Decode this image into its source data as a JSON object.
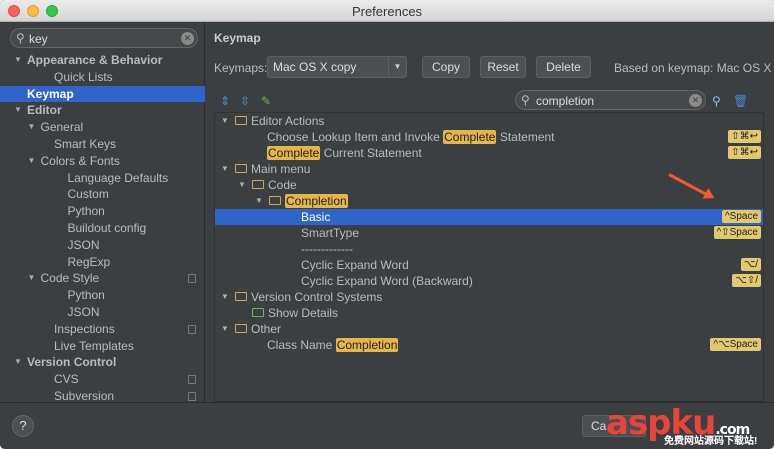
{
  "window": {
    "title": "Preferences"
  },
  "sidebar": {
    "search_value": "key",
    "items": [
      {
        "label": "Appearance & Behavior",
        "indent": 0,
        "arrow": true,
        "bold": true
      },
      {
        "label": "Quick Lists",
        "indent": 2
      },
      {
        "label": "Keymap",
        "indent": 1,
        "selected": true
      },
      {
        "label": "Editor",
        "indent": 0,
        "arrow": true,
        "bold": true
      },
      {
        "label": "General",
        "indent": 1,
        "arrow": true
      },
      {
        "label": "Smart Keys",
        "indent": 2
      },
      {
        "label": "Colors & Fonts",
        "indent": 1,
        "arrow": true
      },
      {
        "label": "Language Defaults",
        "indent": 3
      },
      {
        "label": "Custom",
        "indent": 3
      },
      {
        "label": "Python",
        "indent": 3
      },
      {
        "label": "Buildout config",
        "indent": 3
      },
      {
        "label": "JSON",
        "indent": 3
      },
      {
        "label": "RegExp",
        "indent": 3
      },
      {
        "label": "Code Style",
        "indent": 1,
        "arrow": true,
        "copy": true
      },
      {
        "label": "Python",
        "indent": 3
      },
      {
        "label": "JSON",
        "indent": 3
      },
      {
        "label": "Inspections",
        "indent": 2,
        "copy": true
      },
      {
        "label": "Live Templates",
        "indent": 2
      },
      {
        "label": "Version Control",
        "indent": 0,
        "arrow": true,
        "bold": true
      },
      {
        "label": "CVS",
        "indent": 2,
        "copy": true
      },
      {
        "label": "Subversion",
        "indent": 2,
        "copy": true
      }
    ]
  },
  "main": {
    "heading": "Keymap",
    "keymaps_label": "Keymaps:",
    "keymap_selected": "Mac OS X copy",
    "copy_label": "Copy",
    "reset_label": "Reset",
    "delete_label": "Delete",
    "based_on": "Based on keymap: Mac OS X",
    "search_value": "completion",
    "tree": [
      {
        "level": 0,
        "arrow": true,
        "icon": "edit",
        "parts": [
          [
            "Editor Actions",
            false
          ]
        ]
      },
      {
        "level": 2,
        "parts": [
          [
            "Choose Lookup Item and Invoke ",
            false
          ],
          [
            "Complete",
            true
          ],
          [
            " Statement",
            false
          ]
        ],
        "shortcut": "⇧⌘↩"
      },
      {
        "level": 2,
        "parts": [
          [
            "Complete",
            true
          ],
          [
            " Current Statement",
            false
          ]
        ],
        "shortcut": "⇧⌘↩"
      },
      {
        "level": 0,
        "arrow": true,
        "icon": "menu",
        "parts": [
          [
            "Main menu",
            false
          ]
        ]
      },
      {
        "level": 1,
        "arrow": true,
        "icon": "folder",
        "parts": [
          [
            "Code",
            false
          ]
        ]
      },
      {
        "level": 2,
        "arrow": true,
        "icon": "folder",
        "parts": [
          [
            "Completion",
            true
          ]
        ]
      },
      {
        "level": 4,
        "parts": [
          [
            "Basic",
            false
          ]
        ],
        "shortcut": "^Space",
        "selected": true
      },
      {
        "level": 4,
        "parts": [
          [
            "SmartType",
            false
          ]
        ],
        "shortcut": "^⇧Space"
      },
      {
        "level": 4,
        "parts": [
          [
            "-------------",
            false
          ]
        ]
      },
      {
        "level": 4,
        "parts": [
          [
            "Cyclic Expand Word",
            false
          ]
        ],
        "shortcut": "⌥/"
      },
      {
        "level": 4,
        "parts": [
          [
            "Cyclic Expand Word (Backward)",
            false
          ]
        ],
        "shortcut": "⌥⇧/"
      },
      {
        "level": 0,
        "arrow": true,
        "icon": "folder",
        "parts": [
          [
            "Version Control Systems",
            false
          ]
        ]
      },
      {
        "level": 1,
        "icon": "details",
        "parts": [
          [
            "Show Details",
            false
          ]
        ]
      },
      {
        "level": 0,
        "arrow": true,
        "icon": "other",
        "parts": [
          [
            "Other",
            false
          ]
        ]
      },
      {
        "level": 2,
        "parts": [
          [
            "Class Name ",
            false
          ],
          [
            "Completion",
            true
          ]
        ],
        "shortcut": "^⌥Space"
      }
    ]
  },
  "footer": {
    "help_label": "?",
    "cancel_label": "Ca",
    "watermark_main": "aspku",
    "watermark_dot": ".com",
    "watermark_sub": "免费网站源码下载站!"
  },
  "colors": {
    "selection": "#2f65ca",
    "highlight": "#e5b74a",
    "background": "#3c3f41"
  }
}
